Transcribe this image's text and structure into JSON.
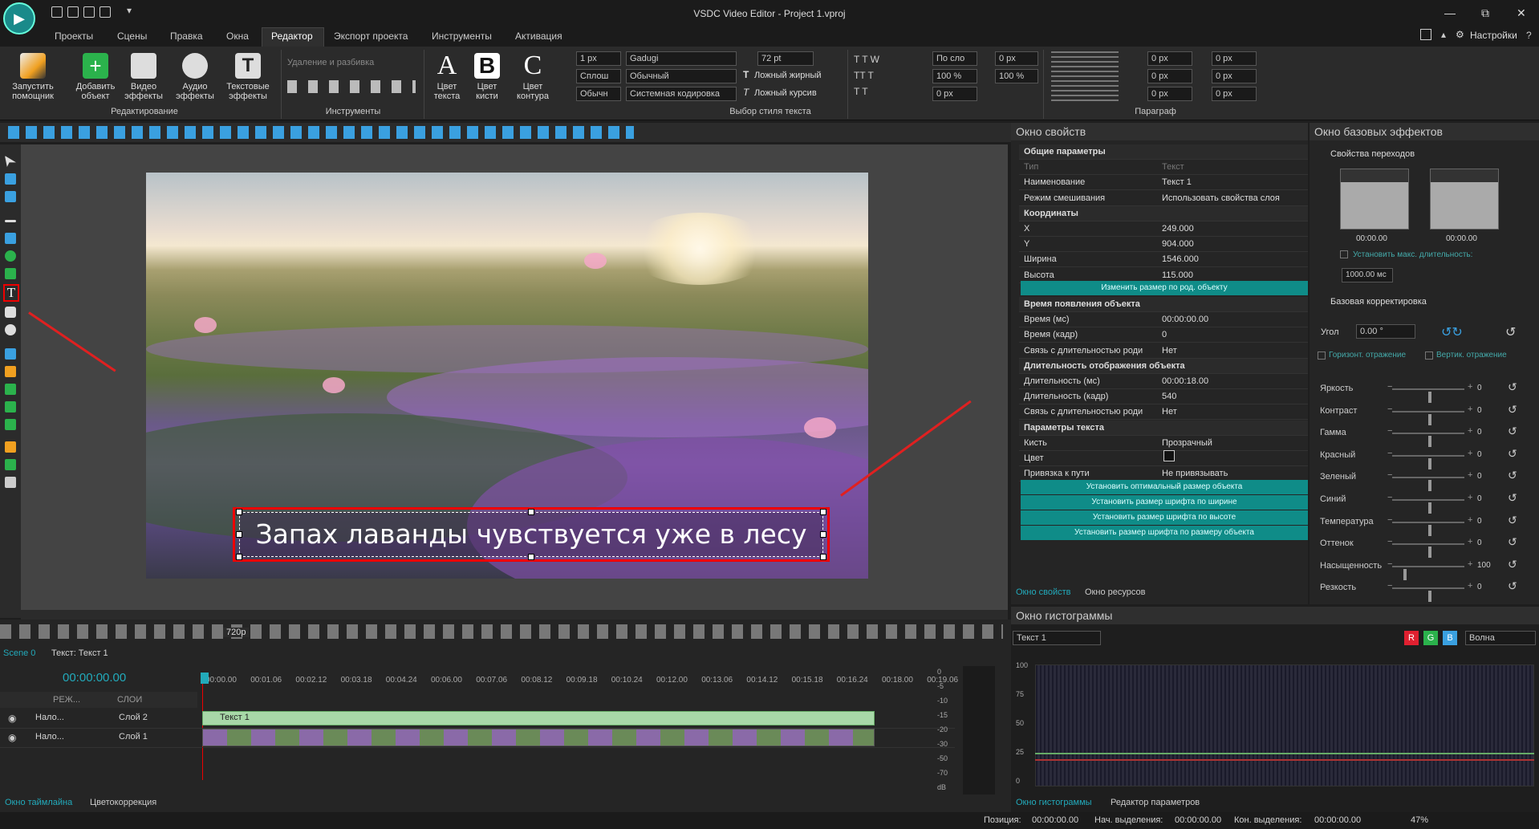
{
  "window": {
    "title": "VSDC Video Editor - Project 1.vproj",
    "min": "—",
    "restore": "⧉",
    "close": "✕",
    "settings": "Настройки"
  },
  "menu": [
    "Проекты",
    "Сцены",
    "Правка",
    "Окна",
    "Редактор",
    "Экспорт проекта",
    "Инструменты",
    "Активация"
  ],
  "ribbon": {
    "buttons": [
      {
        "label": "Запустить помощник",
        "icon": "wand-icon"
      },
      {
        "label": "Добавить объект",
        "icon": "add-object-icon"
      },
      {
        "label": "Видео эффекты",
        "icon": "video-effects-icon"
      },
      {
        "label": "Аудио эффекты",
        "icon": "audio-effects-icon"
      },
      {
        "label": "Текстовые эффекты",
        "icon": "text-effects-icon"
      }
    ],
    "group_edit": "Редактирование",
    "remove_split": "Удаление и разбивка",
    "group_tools": "Инструменты",
    "text_color": "Цвет текста",
    "brush_color": "Цвет кисти",
    "outline_color": "Цвет контура",
    "stroke_width": "1 px",
    "solid": "Сплош",
    "normal_short": "Обычн",
    "font": "Gadugi",
    "style": "Обычный",
    "encoding": "Системная кодировка",
    "font_size": "72 pt",
    "fake_bold": "Ложный жирный",
    "fake_italic": "Ложный курсив",
    "group_text_style": "Выбор стиля текста",
    "align_mode": "По сло",
    "zero_px": "0 px",
    "pct100": "100 %",
    "group_paragraph": "Параграф"
  },
  "video": {
    "caption": "Запах лаванды чувствуется уже в лесу"
  },
  "properties": {
    "title": "Окно свойств",
    "rows": [
      {
        "k": "Общие параметры",
        "v": "",
        "sec": true
      },
      {
        "k": "Тип",
        "v": "Текст",
        "dim": true
      },
      {
        "k": "Наименование",
        "v": "Текст 1"
      },
      {
        "k": "Режим смешивания",
        "v": "Использовать свойства слоя"
      },
      {
        "k": "Координаты",
        "v": "",
        "sec": true
      },
      {
        "k": "X",
        "v": "249.000"
      },
      {
        "k": "Y",
        "v": "904.000"
      },
      {
        "k": "Ширина",
        "v": "1546.000"
      },
      {
        "k": "Высота",
        "v": "115.000"
      }
    ],
    "resize_btn": "Изменить размер по род. объекту",
    "rows2": [
      {
        "k": "Время появления объекта",
        "v": "",
        "sec": true
      },
      {
        "k": "Время (мс)",
        "v": "00:00:00.00"
      },
      {
        "k": "Время (кадр)",
        "v": "0"
      },
      {
        "k": "Связь с длительностью роди",
        "v": "Нет"
      },
      {
        "k": "Длительность отображения объекта",
        "v": "",
        "sec": true
      },
      {
        "k": "Длительность (мс)",
        "v": "00:00:18.00"
      },
      {
        "k": "Длительность (кадр)",
        "v": "540"
      },
      {
        "k": "Связь с длительностью роди",
        "v": "Нет"
      },
      {
        "k": "Параметры текста",
        "v": "",
        "sec": true
      },
      {
        "k": "Кисть",
        "v": "Прозрачный"
      },
      {
        "k": "Цвет",
        "v": ""
      },
      {
        "k": "Привязка к пути",
        "v": "Не привязывать"
      }
    ],
    "buttons": [
      "Установить оптимальный размер объекта",
      "Установить размер шрифта по ширине",
      "Установить размер шрифта по высоте",
      "Установить размер шрифта по размеру объекта"
    ],
    "tab1": "Окно свойств",
    "tab2": "Окно ресурсов"
  },
  "effects": {
    "title": "Окно базовых эффектов",
    "transitions": "Свойства переходов",
    "t1": "00:00.00",
    "t2": "00:00.00",
    "max_dur": "Установить макс. длительность:",
    "ms": "1000.00 мс",
    "basic": "Базовая корректировка",
    "angle_label": "Угол",
    "angle_val": "0.00 °",
    "hflip": "Горизонт. отражение",
    "vflip": "Вертик. отражение",
    "sliders": [
      {
        "name": "Яркость",
        "value": "0"
      },
      {
        "name": "Контраст",
        "value": "0"
      },
      {
        "name": "Гамма",
        "value": "0"
      },
      {
        "name": "Красный",
        "value": "0"
      },
      {
        "name": "Зеленый",
        "value": "0"
      },
      {
        "name": "Синий",
        "value": "0"
      },
      {
        "name": "Температура",
        "value": "0"
      },
      {
        "name": "Оттенок",
        "value": "0"
      },
      {
        "name": "Насыщенность",
        "value": "100"
      },
      {
        "name": "Резкость",
        "value": "0"
      }
    ]
  },
  "timeline": {
    "resolution": "720p",
    "tab_scene": "Scene 0",
    "tab_text": "Текст: Текст 1",
    "time": "00:00:00.00",
    "ruler": [
      "00:00.00",
      "00:01.06",
      "00:02.12",
      "00:03.18",
      "00:04.24",
      "00:06.00",
      "00:07.06",
      "00:08.12",
      "00:09.18",
      "00:10.24",
      "00:12.00",
      "00:13.06",
      "00:14.12",
      "00:15.18",
      "00:16.24",
      "00:18.00",
      "00:19.06"
    ],
    "header_mode": "РЕЖ...",
    "header_layers": "СЛОИ",
    "rows": [
      {
        "mode": "Нало...",
        "layer": "Слой 2",
        "clip": "Текст 1"
      },
      {
        "mode": "Нало...",
        "layer": "Слой 1",
        "clip": ""
      }
    ],
    "db": [
      "0",
      "-5",
      "-10",
      "-15",
      "-20",
      "-30",
      "-50",
      "-70",
      "dB"
    ],
    "tab_timeline": "Окно таймлайна",
    "tab_color": "Цветокоррекция"
  },
  "histogram": {
    "title": "Окно гистограммы",
    "source": "Текст 1",
    "mode": "Волна",
    "r": "R",
    "g": "G",
    "b": "B",
    "scale": [
      "100",
      "75",
      "50",
      "25",
      "0"
    ],
    "tab1": "Окно гистограммы",
    "tab2": "Редактор параметров"
  },
  "status": {
    "pos_label": "Позиция:",
    "pos": "00:00:00.00",
    "sel_start_label": "Нач. выделения:",
    "sel_start": "00:00:00.00",
    "sel_end_label": "Кон. выделения:",
    "sel_end": "00:00:00.00",
    "zoom": "47%"
  }
}
